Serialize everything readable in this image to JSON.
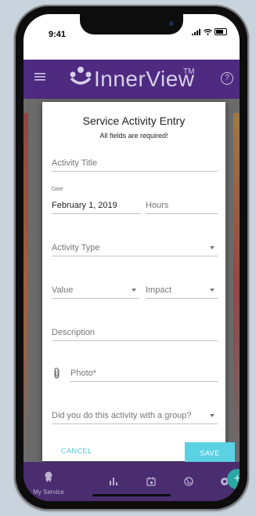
{
  "status": {
    "time": "9:41"
  },
  "app": {
    "title": "InnerView",
    "trademark": "TM",
    "help_label": "?"
  },
  "dialog": {
    "title": "Service Activity Entry",
    "subtitle": "All fields are required!",
    "activity_title_placeholder": "Activity Title",
    "date_label": "Date",
    "date_value": "February 1, 2019",
    "hours_placeholder": "Hours",
    "activity_type_placeholder": "Activity Type",
    "value_placeholder": "Value",
    "impact_placeholder": "Impact",
    "description_placeholder": "Description",
    "photo_placeholder": "Photo*",
    "group_placeholder": "Did you do this activity with a group?",
    "cancel_label": "CANCEL",
    "save_label": "SAVE"
  },
  "fab": {
    "label": "+"
  },
  "nav": {
    "items": [
      {
        "label": "My Service",
        "icon": "my-service-icon"
      },
      {
        "label": "",
        "icon": "stats-icon"
      },
      {
        "label": "",
        "icon": "calendar-icon"
      },
      {
        "label": "",
        "icon": "globe-icon"
      },
      {
        "label": "",
        "icon": "settings-icon"
      }
    ]
  },
  "colors": {
    "appbar": "#4e2a80",
    "bottomnav": "#4a2d6f",
    "accent": "#5ad2e3",
    "fab": "#2aa6a3"
  }
}
